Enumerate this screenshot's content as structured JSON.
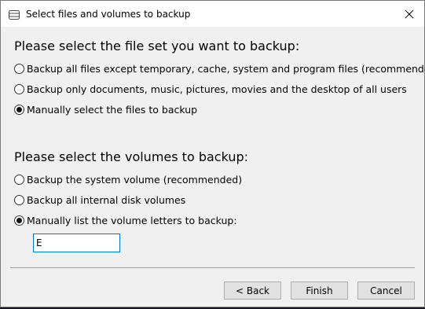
{
  "window": {
    "title": "Select files and volumes to backup"
  },
  "fileset": {
    "heading": "Please select the file set you want to backup:",
    "options": [
      {
        "label": "Backup all files except temporary, cache, system and program files (recommended)",
        "checked": false
      },
      {
        "label": "Backup only documents, music, pictures, movies and the desktop of all users",
        "checked": false
      },
      {
        "label": "Manually select the files to backup",
        "checked": true
      }
    ]
  },
  "volumes": {
    "heading": "Please select the volumes to backup:",
    "options": [
      {
        "label": "Backup the system volume (recommended)",
        "checked": false
      },
      {
        "label": "Backup all internal disk volumes",
        "checked": false
      },
      {
        "label": "Manually list the volume letters to backup:",
        "checked": true
      }
    ],
    "letters_value": "E"
  },
  "buttons": {
    "back": "< Back",
    "finish": "Finish",
    "cancel": "Cancel"
  },
  "icons": {
    "title": "drive-icon",
    "close": "close-icon"
  }
}
